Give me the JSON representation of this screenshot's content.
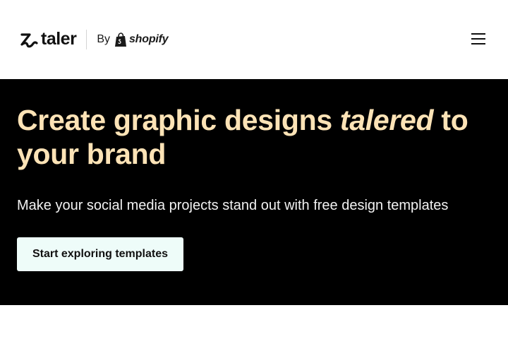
{
  "header": {
    "logo_text": "taler",
    "by_label": "By",
    "partner_text": "shopify",
    "logo_icon": "taler-swirl-icon",
    "partner_icon": "shopify-bag-icon",
    "menu_icon": "hamburger-menu-icon"
  },
  "hero": {
    "title_part1": "Create graphic designs ",
    "title_emphasis": "talered",
    "title_part2": " to your brand",
    "subtitle": "Make your social media projects stand out with free design templates",
    "cta_label": "Start exploring templates"
  },
  "colors": {
    "hero_background": "#000000",
    "title_color": "#fde3b6",
    "cta_background": "#eefcf9",
    "header_background": "#ffffff"
  }
}
